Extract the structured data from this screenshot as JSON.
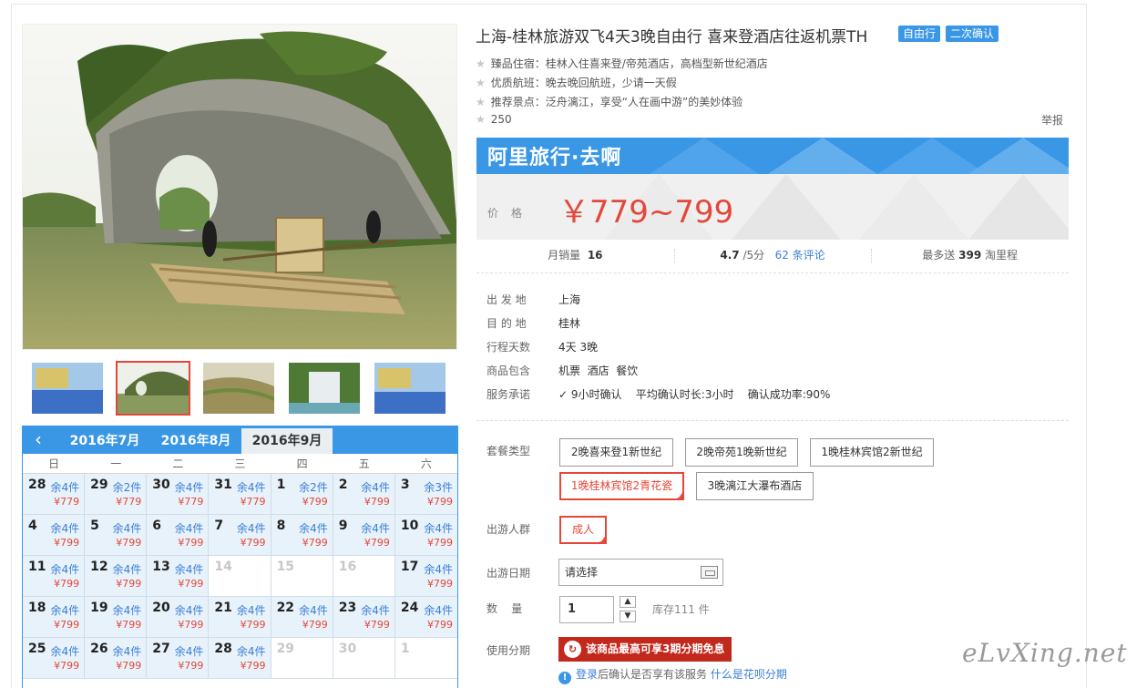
{
  "product": {
    "title": "上海-桂林旅游双飞4天3晚自由行 喜来登酒店往返机票TH",
    "tags": [
      "自由行",
      "二次确认"
    ],
    "features": [
      "臻品住宿：桂林入住喜来登/帝苑酒店，高档型新世纪酒店",
      "优质航班：晚去晚回航班，少请一天假",
      "推荐景点：泛舟漓江，享受“人在画中游”的美妙体验"
    ],
    "favorites": "250",
    "report_label": "举报"
  },
  "brand": "阿里旅行·去啊",
  "price": {
    "label": "价格",
    "value": "￥779~799"
  },
  "stats": {
    "sales_label": "月销量",
    "sales_value": "16",
    "rating_value": "4.7",
    "rating_suffix": "/5分",
    "reviews_link": "62 条评论",
    "points_prefix": "最多送",
    "points_value": "399",
    "points_suffix": "淘里程"
  },
  "info": [
    {
      "label": "出 发 地",
      "value": "上海"
    },
    {
      "label": "目 的 地",
      "value": "桂林"
    },
    {
      "label": "行程天数",
      "value": "4天 3晚"
    },
    {
      "label": "商品包含",
      "value": "机票  酒店  餐饮"
    },
    {
      "label": "服务承诺",
      "value": "9小时确认    平均确认时长:3小时    确认成功率:90%"
    }
  ],
  "package": {
    "label": "套餐类型",
    "options": [
      "2晚喜来登1新世纪",
      "2晚帝苑1晚新世纪",
      "1晚桂林宾馆2新世纪",
      "1晚桂林宾馆2青花瓷",
      "3晚漓江大瀑布酒店"
    ],
    "selected": "1晚桂林宾馆2青花瓷"
  },
  "traveler": {
    "label": "出游人群",
    "options": [
      "成人"
    ]
  },
  "date": {
    "label": "出游日期",
    "value": "请选择"
  },
  "quantity": {
    "label": "数    量",
    "value": "1",
    "stock": "库存111 件"
  },
  "installment": {
    "label": "使用分期",
    "button": "该商品最高可享3期分期免息",
    "tip_link": "登录",
    "tip_text": "后确认是否享有该服务",
    "tip_link2": "什么是花呗分期"
  },
  "calendar": {
    "tabs": [
      "2016年7月",
      "2016年8月",
      "2016年9月"
    ],
    "active_tab": "2016年9月",
    "weekdays": [
      "日",
      "一",
      "二",
      "三",
      "四",
      "五",
      "六"
    ],
    "cells": [
      {
        "d": "28",
        "s": "余4件",
        "p": "¥779"
      },
      {
        "d": "29",
        "s": "余2件",
        "p": "¥779"
      },
      {
        "d": "30",
        "s": "余4件",
        "p": "¥779"
      },
      {
        "d": "31",
        "s": "余4件",
        "p": "¥779"
      },
      {
        "d": "1",
        "s": "余2件",
        "p": "¥799"
      },
      {
        "d": "2",
        "s": "余4件",
        "p": "¥799"
      },
      {
        "d": "3",
        "s": "余3件",
        "p": "¥799"
      },
      {
        "d": "4",
        "s": "余4件",
        "p": "¥799"
      },
      {
        "d": "5",
        "s": "余4件",
        "p": "¥799"
      },
      {
        "d": "6",
        "s": "余4件",
        "p": "¥799"
      },
      {
        "d": "7",
        "s": "余4件",
        "p": "¥799"
      },
      {
        "d": "8",
        "s": "余4件",
        "p": "¥799"
      },
      {
        "d": "9",
        "s": "余4件",
        "p": "¥799"
      },
      {
        "d": "10",
        "s": "余4件",
        "p": "¥799"
      },
      {
        "d": "11",
        "s": "余4件",
        "p": "¥799"
      },
      {
        "d": "12",
        "s": "余4件",
        "p": "¥799"
      },
      {
        "d": "13",
        "s": "余4件",
        "p": "¥799"
      },
      {
        "d": "14",
        "s": "",
        "p": "",
        "off": true
      },
      {
        "d": "15",
        "s": "",
        "p": "",
        "off": true
      },
      {
        "d": "16",
        "s": "",
        "p": "",
        "off": true
      },
      {
        "d": "17",
        "s": "余4件",
        "p": "¥799"
      },
      {
        "d": "18",
        "s": "余4件",
        "p": "¥799"
      },
      {
        "d": "19",
        "s": "余4件",
        "p": "¥799"
      },
      {
        "d": "20",
        "s": "余4件",
        "p": "¥799"
      },
      {
        "d": "21",
        "s": "余4件",
        "p": "¥799"
      },
      {
        "d": "22",
        "s": "余4件",
        "p": "¥799"
      },
      {
        "d": "23",
        "s": "余4件",
        "p": "¥799"
      },
      {
        "d": "24",
        "s": "余4件",
        "p": "¥799"
      },
      {
        "d": "25",
        "s": "余4件",
        "p": "¥799"
      },
      {
        "d": "26",
        "s": "余4件",
        "p": "¥799"
      },
      {
        "d": "27",
        "s": "余4件",
        "p": "¥799"
      },
      {
        "d": "28",
        "s": "余4件",
        "p": "¥799"
      },
      {
        "d": "29",
        "s": "",
        "p": "",
        "off": true
      },
      {
        "d": "30",
        "s": "",
        "p": "",
        "off": true
      },
      {
        "d": "1",
        "s": "",
        "p": "",
        "off": true
      }
    ]
  },
  "watermark": "eLvXing.net",
  "colors": {
    "accent": "#3a97e6",
    "price": "#e4473a",
    "fenqi": "#c2291c"
  }
}
